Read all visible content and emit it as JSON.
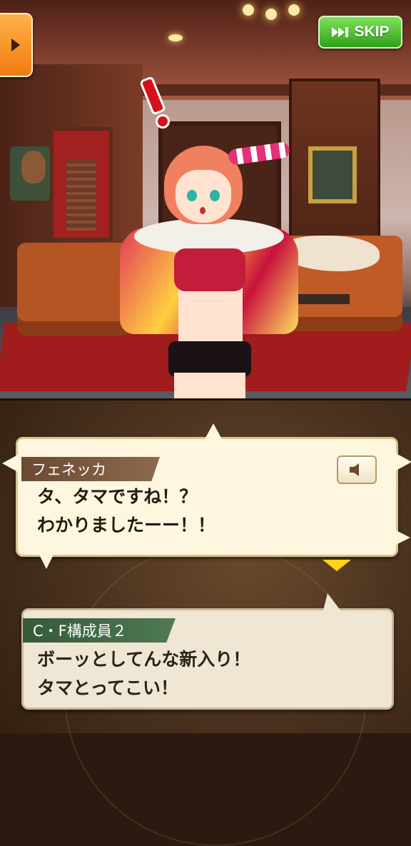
{
  "header": {
    "skip_label": "SKIP",
    "menu_icon": "triangle-right-icon",
    "skip_icon": "fast-forward-icon"
  },
  "dialogue": {
    "current": {
      "speaker": "フェネッカ",
      "line1": "タ、タマですね！？",
      "line2": "わかりましたーー！！",
      "voice_icon": "speaker-icon"
    },
    "previous": {
      "speaker": "C・F構成員２",
      "line1": "ボーッとしてんな新入り！",
      "line2": "タマとってこい！"
    },
    "next_indicator_icon": "down-triangle-icon"
  },
  "colors": {
    "skip_green": "#2ea21a",
    "menu_orange": "#f07a12",
    "speaker_plate": "#6a4a34",
    "previous_plate": "#345a3a",
    "next_arrow": "#ffd21c"
  }
}
